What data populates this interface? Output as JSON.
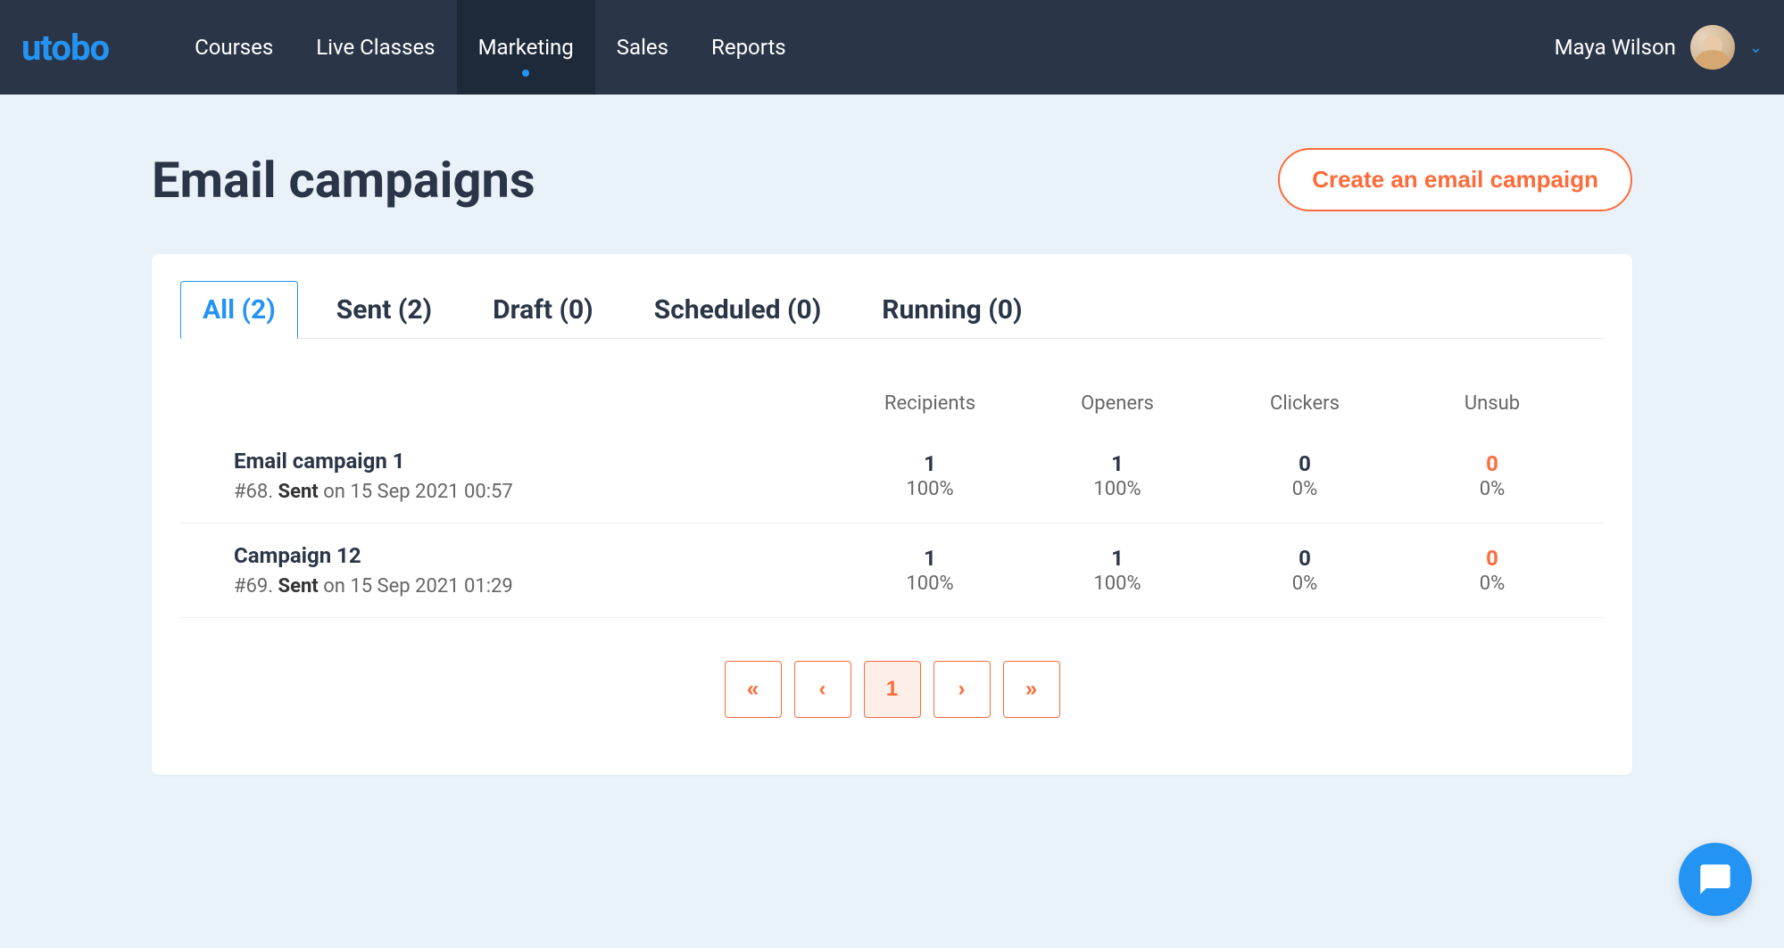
{
  "brand": "utobo",
  "nav": {
    "items": [
      "Courses",
      "Live Classes",
      "Marketing",
      "Sales",
      "Reports"
    ],
    "activeIndex": 2
  },
  "user": {
    "name": "Maya Wilson"
  },
  "page": {
    "title": "Email campaigns",
    "createBtn": "Create an email campaign"
  },
  "tabs": [
    {
      "label": "All (2)",
      "active": true
    },
    {
      "label": "Sent (2)",
      "active": false
    },
    {
      "label": "Draft (0)",
      "active": false
    },
    {
      "label": "Scheduled (0)",
      "active": false
    },
    {
      "label": "Running (0)",
      "active": false
    }
  ],
  "table": {
    "headers": [
      "Recipients",
      "Openers",
      "Clickers",
      "Unsub"
    ],
    "rows": [
      {
        "title": "Email campaign 1",
        "id": "#68.",
        "status": "Sent",
        "on": " on 15 Sep 2021 00:57",
        "recipients": {
          "v": "1",
          "p": "100%"
        },
        "openers": {
          "v": "1",
          "p": "100%"
        },
        "clickers": {
          "v": "0",
          "p": "0%"
        },
        "unsub": {
          "v": "0",
          "p": "0%",
          "orange": true
        }
      },
      {
        "title": "Campaign 12",
        "id": "#69.",
        "status": "Sent",
        "on": " on 15 Sep 2021 01:29",
        "recipients": {
          "v": "1",
          "p": "100%"
        },
        "openers": {
          "v": "1",
          "p": "100%"
        },
        "clickers": {
          "v": "0",
          "p": "0%"
        },
        "unsub": {
          "v": "0",
          "p": "0%",
          "orange": true
        }
      }
    ]
  },
  "pagination": {
    "first": "«",
    "prev": "‹",
    "pages": [
      "1"
    ],
    "next": "›",
    "last": "»",
    "activeIndex": 0
  }
}
